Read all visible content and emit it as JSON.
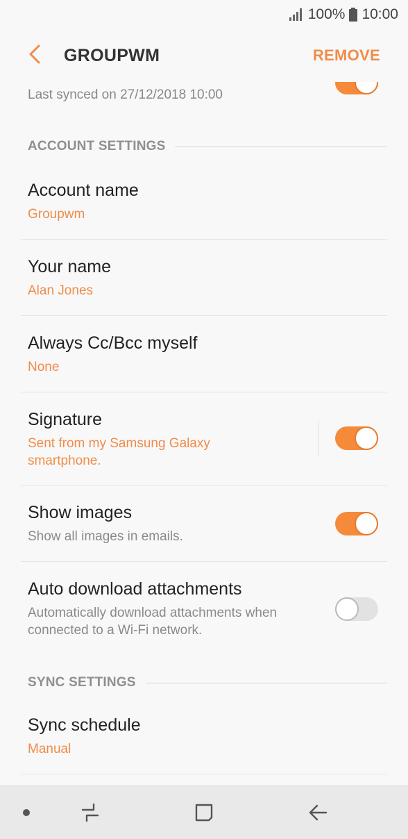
{
  "status": {
    "battery": "100%",
    "time": "10:00"
  },
  "header": {
    "title": "GROUPWM",
    "remove_label": "REMOVE"
  },
  "sync_top": {
    "last_synced": "Last synced on 27/12/2018  10:00",
    "enabled": true
  },
  "sections": {
    "account": "ACCOUNT SETTINGS",
    "sync": "SYNC SETTINGS"
  },
  "account_name": {
    "label": "Account name",
    "value": "Groupwm"
  },
  "your_name": {
    "label": "Your name",
    "value": "Alan Jones"
  },
  "cc_bcc": {
    "label": "Always Cc/Bcc myself",
    "value": "None"
  },
  "signature": {
    "label": "Signature",
    "value_line1": "Sent from my Samsung Galaxy",
    "value_line2": "smartphone.",
    "enabled": true
  },
  "show_images": {
    "label": "Show images",
    "desc": "Show all images in emails.",
    "enabled": true
  },
  "auto_download": {
    "label": "Auto download attachments",
    "desc_line1": "Automatically download attachments when",
    "desc_line2": "connected to a Wi-Fi network.",
    "enabled": false
  },
  "sync_schedule": {
    "label": "Sync schedule",
    "value": "Manual"
  },
  "colors": {
    "accent": "#f08c4a",
    "toggle_on": "#f58a3a",
    "toggle_off": "#e2e2e2"
  },
  "nav": {
    "icons": [
      "dot-icon",
      "recent-apps-icon",
      "home-icon",
      "back-icon"
    ]
  }
}
